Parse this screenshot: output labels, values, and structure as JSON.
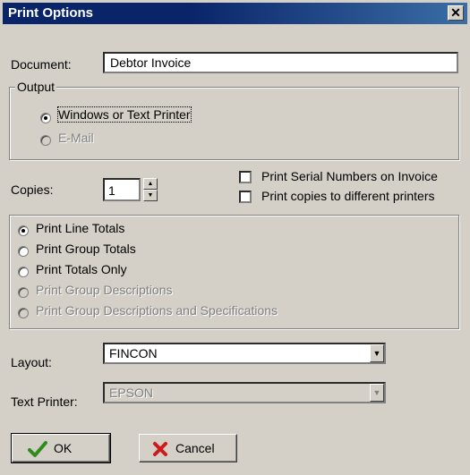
{
  "window": {
    "title": "Print Options"
  },
  "document": {
    "label": "Document:",
    "value": "Debtor Invoice"
  },
  "output": {
    "caption": "Output",
    "options": [
      {
        "label": "Windows or Text Printer",
        "selected": true,
        "enabled": true
      },
      {
        "label": "E-Mail",
        "selected": false,
        "enabled": false
      }
    ]
  },
  "copies": {
    "label": "Copies:",
    "value": "1"
  },
  "checkboxes": [
    {
      "label": "Print Serial Numbers on Invoice",
      "checked": false
    },
    {
      "label": "Print copies to different printers",
      "checked": false
    }
  ],
  "totals": {
    "options": [
      {
        "label": "Print Line Totals",
        "selected": true,
        "enabled": true
      },
      {
        "label": "Print Group Totals",
        "selected": false,
        "enabled": true
      },
      {
        "label": "Print Totals Only",
        "selected": false,
        "enabled": true
      },
      {
        "label": "Print Group Descriptions",
        "selected": false,
        "enabled": false
      },
      {
        "label": "Print Group Descriptions and Specifications",
        "selected": false,
        "enabled": false
      }
    ]
  },
  "layout": {
    "label": "Layout:",
    "value": "FINCON"
  },
  "text_printer": {
    "label": "Text Printer:",
    "value": "EPSON"
  },
  "buttons": {
    "ok_label": "OK",
    "cancel_label": "Cancel"
  },
  "icons": {
    "ok": "check-icon",
    "cancel": "x-icon",
    "close": "close-icon"
  },
  "colors": {
    "titlebar": "#0a246a",
    "face": "#d4d0c8",
    "ok_check": "#2e8b1e",
    "cancel_x": "#cc1b1b"
  }
}
